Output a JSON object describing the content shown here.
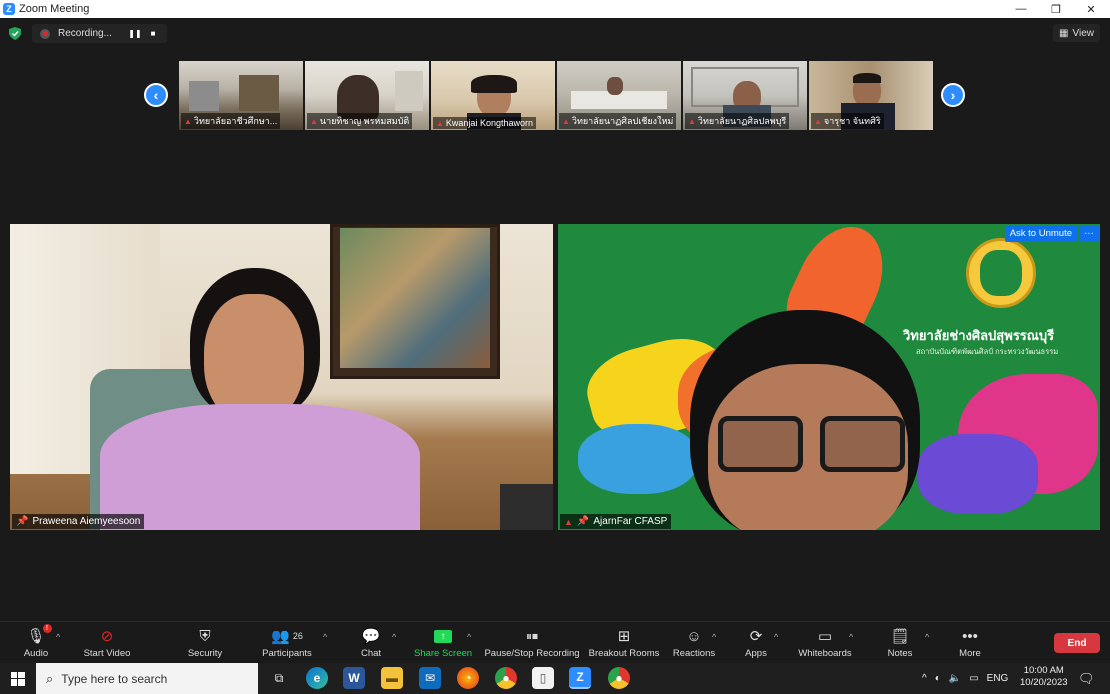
{
  "window": {
    "title": "Zoom Meeting",
    "minimize": "—",
    "restore": "❐",
    "close": "✕"
  },
  "recording": {
    "label": "Recording...",
    "pause": "❚❚",
    "stop": "■"
  },
  "view": {
    "label": "View"
  },
  "thumbnails": [
    {
      "name": "วิทยาลัยอาชีวศึกษา..."
    },
    {
      "name": "นายทิชาญ พรหมสมบัติ"
    },
    {
      "name": "Kwanjai Kongthaworn"
    },
    {
      "name": "วิทยาลัยนาฏศิลปเชียงใหม่"
    },
    {
      "name": "วิทยาลัยนาฏศิลปลพบุรี"
    },
    {
      "name": "จารุชา จันทศิริ"
    }
  ],
  "nav": {
    "prev": "‹",
    "next": "›"
  },
  "main_tiles": {
    "left": {
      "name": "Praweena Aiemyeesoon"
    },
    "right": {
      "name": "AjarnFar CFASP",
      "ask_unmute": "Ask to Unmute",
      "more": "···",
      "logo_text": "วิทยาลัยช่างศิลปสุพรรณบุรี",
      "logo_subtext": "สถาบันบัณฑิตพัฒนศิลป์ กระทรวงวัฒนธรรม"
    }
  },
  "toolbar": {
    "audio": "Audio",
    "start_video": "Start Video",
    "security": "Security",
    "participants": "Participants",
    "participants_count": "26",
    "chat": "Chat",
    "share_screen": "Share Screen",
    "recording": "Pause/Stop Recording",
    "breakout": "Breakout Rooms",
    "reactions": "Reactions",
    "apps": "Apps",
    "whiteboards": "Whiteboards",
    "notes": "Notes",
    "more": "More",
    "end": "End",
    "audio_badge": "!"
  },
  "taskbar": {
    "search_placeholder": "Type here to search",
    "lang": "ENG",
    "time": "10:00 AM",
    "date": "10/20/2023"
  },
  "colors": {
    "accent": "#2d8cff",
    "end": "#d7373f",
    "share": "#23d959"
  }
}
